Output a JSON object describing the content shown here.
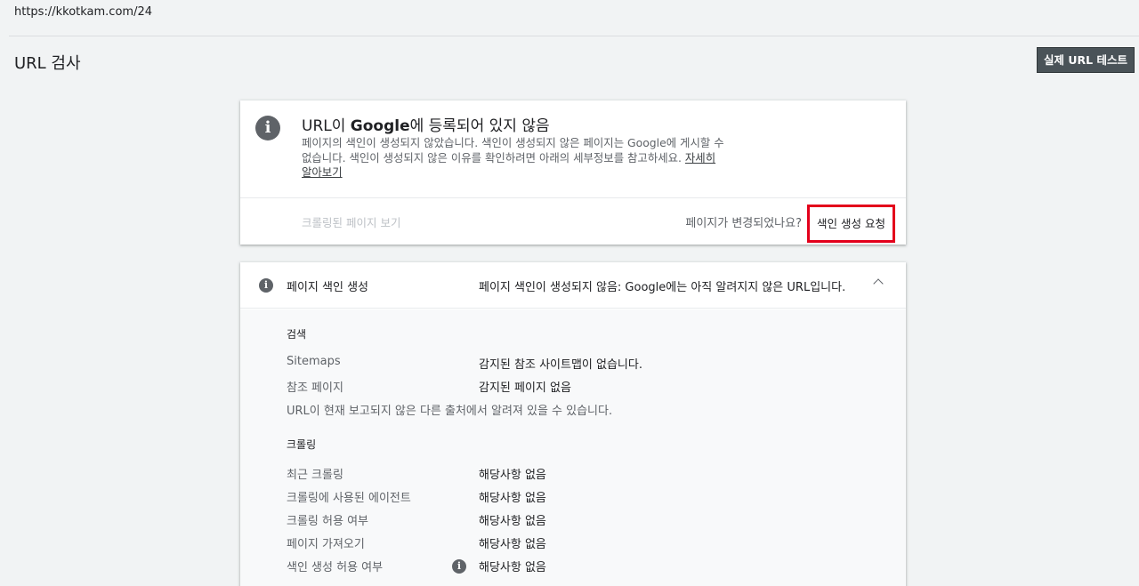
{
  "browser": {
    "url": "https://kkotkam.com/24"
  },
  "header": {
    "title": "URL 검사",
    "live_test_label": "실제 URL 테스트"
  },
  "status_card": {
    "title_prefix": "URL이 ",
    "title_brand": "Google",
    "title_suffix": "에 등록되어 있지 않음",
    "description": "페이지의 색인이 생성되지 않았습니다. 색인이 생성되지 않은 페이지는 Google에 게시할 수 없습니다. 색인이 생성되지 않은 이유를 확인하려면 아래의 세부정보를 참고하세요. ",
    "learn_more": "자세히 알아보기",
    "crawled_page_link": "크롤링된 페이지 보기",
    "changed_question": "페이지가 변경되었나요?",
    "request_index_label": "색인 생성 요청"
  },
  "indexing_section": {
    "label": "페이지 색인 생성",
    "status": "페이지 색인이 생성되지 않음: Google에는 아직 알려지지 않은 URL입니다.",
    "discovery": {
      "title": "검색",
      "rows": [
        {
          "label": "Sitemaps",
          "value": "감지된 참조 사이트맵이 없습니다."
        },
        {
          "label": "참조 페이지",
          "value": "감지된 페이지 없음"
        }
      ],
      "note": "URL이 현재 보고되지 않은 다른 출처에서 알려져 있을 수 있습니다."
    },
    "crawl": {
      "title": "크롤링",
      "rows": [
        {
          "label": "최근 크롤링",
          "value": "해당사항 없음"
        },
        {
          "label": "크롤링에 사용된 에이전트",
          "value": "해당사항 없음"
        },
        {
          "label": "크롤링 허용 여부",
          "value": "해당사항 없음"
        },
        {
          "label": "페이지 가져오기",
          "value": "해당사항 없음"
        },
        {
          "label": "색인 생성 허용 여부",
          "value": "해당사항 없음"
        }
      ]
    }
  },
  "icons": {
    "status_icon": "info-icon",
    "section_icon": "info-icon",
    "collapse_icon": "chevron-up-icon"
  },
  "colors": {
    "highlight_border": "#e3001b",
    "button_bg": "#4a5358",
    "background": "#f1f3f4"
  }
}
